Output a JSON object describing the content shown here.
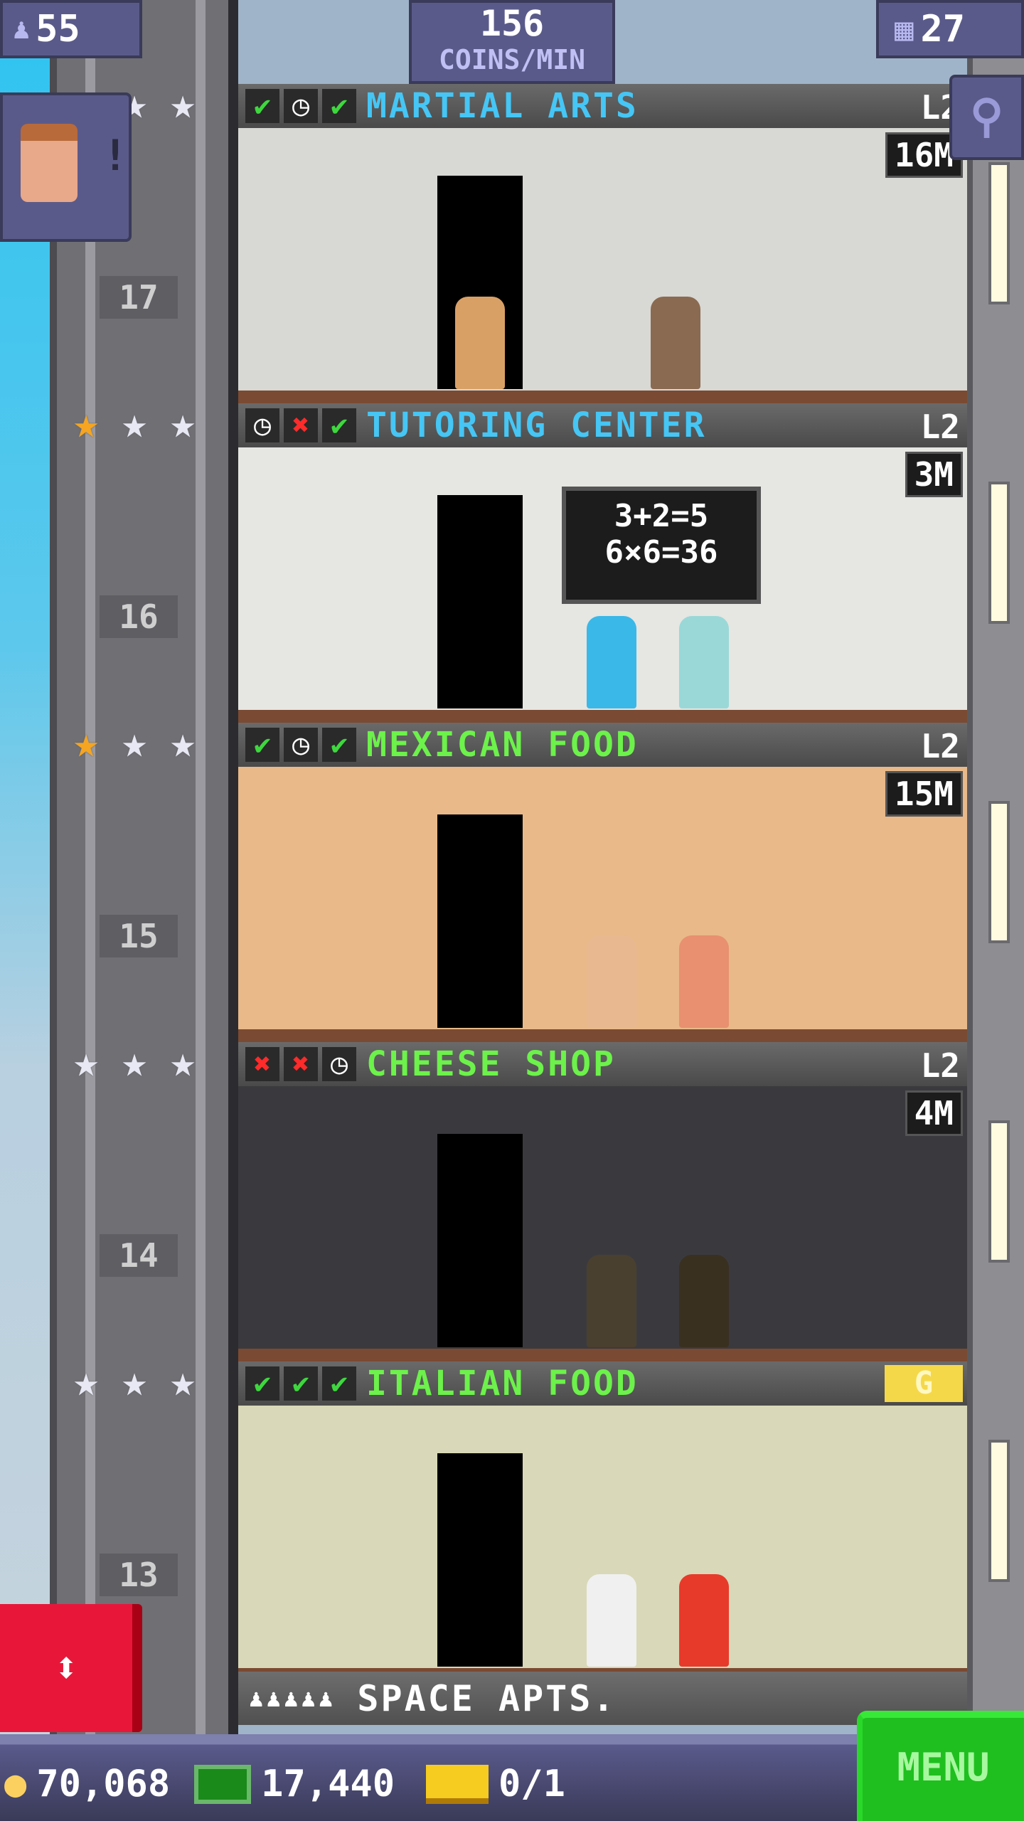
{
  "hud": {
    "population": "55",
    "coins_per_min": "156",
    "coins_per_min_label": "COINS/MIN",
    "floors_count": "27"
  },
  "floors": [
    {
      "number": "17",
      "name": "MARTIAL ARTS",
      "name_color": "#45c6f5",
      "level": "L2",
      "price": "16M",
      "statuses": [
        "check",
        "clock",
        "check"
      ],
      "stars": [
        "silver",
        "silver",
        "silver"
      ],
      "wall": "#d8d8d4"
    },
    {
      "number": "16",
      "name": "TUTORING CENTER",
      "name_color": "#45c6f5",
      "level": "L2",
      "price": "3M",
      "statuses": [
        "clock",
        "x",
        "check"
      ],
      "stars": [
        "gold",
        "silver",
        "silver"
      ],
      "wall": "#e6e6e2",
      "board": [
        "3+2=5",
        "6×6=36"
      ]
    },
    {
      "number": "15",
      "name": "MEXICAN FOOD",
      "name_color": "#6cf24a",
      "level": "L2",
      "price": "15M",
      "statuses": [
        "check",
        "clock",
        "check"
      ],
      "stars": [
        "gold",
        "silver",
        "silver"
      ],
      "wall": "#e9b98a"
    },
    {
      "number": "14",
      "name": "CHEESE SHOP",
      "name_color": "#6cf24a",
      "level": "L2",
      "price": "4M",
      "statuses": [
        "x",
        "x",
        "clock"
      ],
      "stars": [
        "silver",
        "silver",
        "silver"
      ],
      "wall": "#3a3a3e"
    },
    {
      "number": "13",
      "name": "ITALIAN FOOD",
      "name_color": "#6cf24a",
      "badge": "G",
      "statuses": [
        "check",
        "check",
        "check"
      ],
      "stars": [
        "silver",
        "silver",
        "silver"
      ],
      "wall": "#d9d8b8"
    }
  ],
  "next_floor": {
    "name": "SPACE APTS."
  },
  "bottom": {
    "coins": "70,068",
    "bux": "17,440",
    "tickets": "0/1",
    "menu": "MENU"
  },
  "colors": {
    "menu": "#1fbf1f",
    "elevator_button": "#e8173a"
  }
}
